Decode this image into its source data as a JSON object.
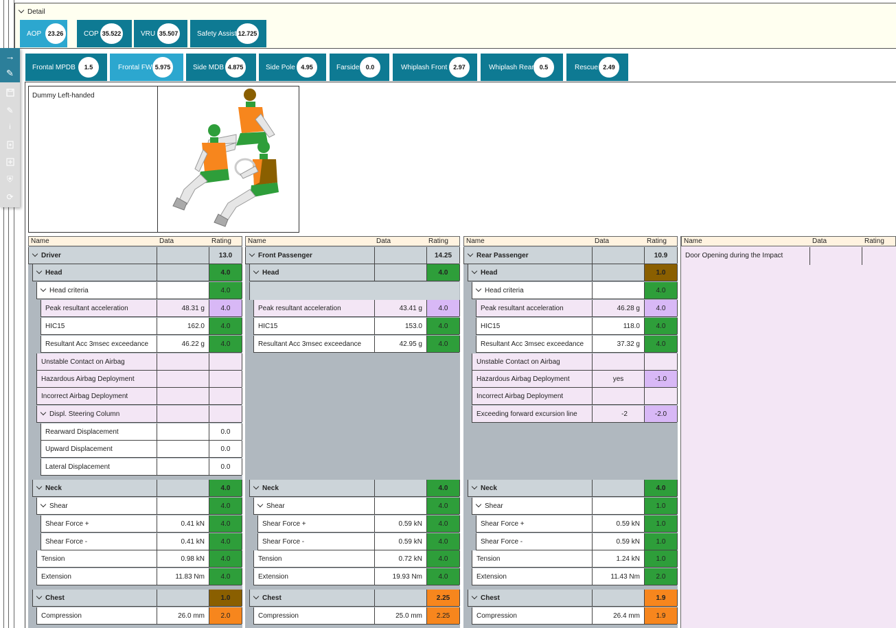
{
  "detail": {
    "title": "Detail"
  },
  "top_tabs": [
    {
      "label": "AOP",
      "value": "23.26"
    },
    {
      "label": "COP",
      "value": "35.522"
    },
    {
      "label": "VRU",
      "value": "35.507"
    },
    {
      "label": "Safety Assist",
      "value": "12.725"
    }
  ],
  "sub_tabs": [
    {
      "label": "Frontal MPDB",
      "value": "1.5"
    },
    {
      "label": "Frontal FW",
      "value": "5.975"
    },
    {
      "label": "Side MDB",
      "value": "4.875"
    },
    {
      "label": "Side Pole",
      "value": "4.95"
    },
    {
      "label": "Farside",
      "value": "0.0"
    },
    {
      "label": "Whiplash Front",
      "value": "2.97"
    },
    {
      "label": "Whiplash Rear",
      "value": "0.5"
    },
    {
      "label": "Rescue",
      "value": "2.49"
    }
  ],
  "toolbar": {
    "arrow": "→",
    "edit": "✎",
    "save": "💾",
    "note": "✎",
    "info": "i",
    "add": "+",
    "shield": "⛨",
    "sync": "⟳"
  },
  "dummy": {
    "label": "Dummy Left-handed"
  },
  "col_headers": {
    "name": "Name",
    "data": "Data",
    "rating": "Rating"
  },
  "driver": {
    "title": "Driver",
    "rating": "13.0",
    "head": {
      "title": "Head",
      "rating": "4.0"
    },
    "head_criteria": {
      "title": "Head criteria",
      "rating": "4.0"
    },
    "peak": {
      "name": "Peak resultant acceleration",
      "data": "48.31 g",
      "rating": "4.0"
    },
    "hic": {
      "name": "HIC15",
      "data": "162.0",
      "rating": "4.0"
    },
    "acc3": {
      "name": "Resultant Acc 3msec exceedance",
      "data": "46.22 g",
      "rating": "4.0"
    },
    "unstable": {
      "name": "Unstable Contact on Airbag"
    },
    "hazard": {
      "name": "Hazardous Airbag Deployment"
    },
    "incorrect": {
      "name": "Incorrect Airbag Deployment"
    },
    "steer": {
      "title": "Displ. Steering Column"
    },
    "rear": {
      "name": "Rearward Displacement",
      "rating": "0.0"
    },
    "up": {
      "name": "Upward Displacement",
      "rating": "0.0"
    },
    "lat": {
      "name": "Lateral Displacement",
      "rating": "0.0"
    },
    "neck": {
      "title": "Neck",
      "rating": "4.0"
    },
    "shear": {
      "title": "Shear",
      "rating": "4.0"
    },
    "sfp": {
      "name": "Shear Force +",
      "data": "0.41 kN",
      "rating": "4.0"
    },
    "sfm": {
      "name": "Shear Force -",
      "data": "0.41 kN",
      "rating": "4.0"
    },
    "tension": {
      "name": "Tension",
      "data": "0.98 kN",
      "rating": "4.0"
    },
    "ext": {
      "name": "Extension",
      "data": "11.83 Nm",
      "rating": "4.0"
    },
    "chest": {
      "title": "Chest",
      "rating": "1.0"
    },
    "comp": {
      "name": "Compression",
      "data": "26.0 mm",
      "rating": "2.0"
    }
  },
  "front": {
    "title": "Front Passenger",
    "rating": "14.25",
    "head": {
      "title": "Head",
      "rating": "4.0"
    },
    "peak": {
      "name": "Peak resultant acceleration",
      "data": "43.41 g",
      "rating": "4.0"
    },
    "hic": {
      "name": "HIC15",
      "data": "153.0",
      "rating": "4.0"
    },
    "acc3": {
      "name": "Resultant Acc 3msec exceedance",
      "data": "42.95 g",
      "rating": "4.0"
    },
    "neck": {
      "title": "Neck",
      "rating": "4.0"
    },
    "shear": {
      "title": "Shear",
      "rating": "4.0"
    },
    "sfp": {
      "name": "Shear Force +",
      "data": "0.59 kN",
      "rating": "4.0"
    },
    "sfm": {
      "name": "Shear Force -",
      "data": "0.59 kN",
      "rating": "4.0"
    },
    "tension": {
      "name": "Tension",
      "data": "0.72 kN",
      "rating": "4.0"
    },
    "ext": {
      "name": "Extension",
      "data": "19.93 Nm",
      "rating": "4.0"
    },
    "chest": {
      "title": "Chest",
      "rating": "2.25"
    },
    "comp": {
      "name": "Compression",
      "data": "25.0 mm",
      "rating": "2.25"
    }
  },
  "rear": {
    "title": "Rear Passenger",
    "rating": "10.9",
    "head": {
      "title": "Head",
      "rating": "1.0"
    },
    "head_criteria": {
      "title": "Head criteria",
      "rating": "4.0"
    },
    "peak": {
      "name": "Peak resultant acceleration",
      "data": "46.28 g",
      "rating": "4.0"
    },
    "hic": {
      "name": "HIC15",
      "data": "118.0",
      "rating": "4.0"
    },
    "acc3": {
      "name": "Resultant Acc 3msec exceedance",
      "data": "37.32 g",
      "rating": "4.0"
    },
    "unstable": {
      "name": "Unstable Contact on Airbag"
    },
    "hazard": {
      "name": "Hazardous Airbag Deployment",
      "data": "yes",
      "rating": "-1.0"
    },
    "incorrect": {
      "name": "Incorrect Airbag Deployment"
    },
    "excursion": {
      "name": "Exceeding forward excursion line",
      "data": "-2",
      "rating": "-2.0"
    },
    "neck": {
      "title": "Neck",
      "rating": "4.0"
    },
    "shear": {
      "title": "Shear",
      "rating": "1.0"
    },
    "sfp": {
      "name": "Shear Force +",
      "data": "0.59 kN",
      "rating": "1.0"
    },
    "sfm": {
      "name": "Shear Force -",
      "data": "0.59 kN",
      "rating": "1.0"
    },
    "tension": {
      "name": "Tension",
      "data": "1.24 kN",
      "rating": "1.0"
    },
    "ext": {
      "name": "Extension",
      "data": "11.43 Nm",
      "rating": "2.0"
    },
    "chest": {
      "title": "Chest",
      "rating": "1.9"
    },
    "comp": {
      "name": "Compression",
      "data": "26.4 mm",
      "rating": "1.9"
    }
  },
  "door": {
    "name": "Door Opening during the Impact"
  }
}
